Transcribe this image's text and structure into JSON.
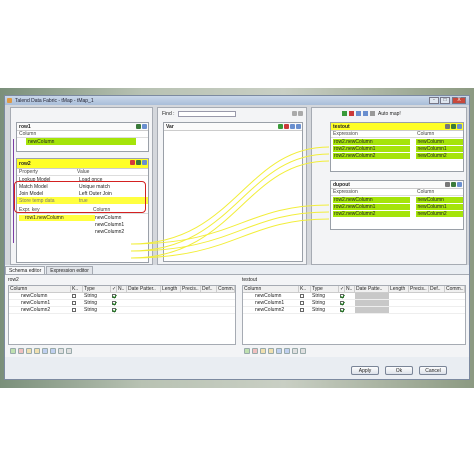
{
  "window": {
    "title": "Talend Data Fabric - tMap - tMap_1",
    "min_label": "-",
    "max_label": "□",
    "close_label": "X"
  },
  "input_row1": {
    "title": "row1",
    "col_header": "Column",
    "columns": [
      "newColumn"
    ]
  },
  "input_row2": {
    "title": "row2",
    "property_header": "Property",
    "value_header": "Value",
    "properties": [
      {
        "name": "Lookup Model",
        "value": "Load once"
      },
      {
        "name": "Match Model",
        "value": "Unique match"
      },
      {
        "name": "Join Model",
        "value": "Left Outer Join"
      },
      {
        "name": "Store temp data",
        "value": "true"
      }
    ],
    "expr_header": "Expr. key",
    "column_header": "Column",
    "rows": [
      {
        "expr": "row1.newColumn",
        "column": "newColumn"
      },
      {
        "expr": "",
        "column": "newColumn1"
      },
      {
        "expr": "",
        "column": "newColumn2"
      }
    ]
  },
  "var_panel": {
    "find_label": "Find :",
    "title": "Var"
  },
  "auto_map_label": "Auto map!",
  "output_testout": {
    "title": "testout",
    "expr_header": "Expression",
    "column_header": "Column",
    "rows": [
      {
        "expr": "row2.newColumn",
        "column": "newColumn"
      },
      {
        "expr": "row2.newColumn1",
        "column": "newColumn1"
      },
      {
        "expr": "row2.newColumn2",
        "column": "newColumn2"
      }
    ]
  },
  "output_dupout": {
    "title": "dupout",
    "expr_header": "Expression",
    "column_header": "Column",
    "rows": [
      {
        "expr": "row2.newColumn",
        "column": "newColumn"
      },
      {
        "expr": "row2.newColumn1",
        "column": "newColumn1"
      },
      {
        "expr": "row2.newColumn2",
        "column": "newColumn2"
      }
    ]
  },
  "tabs": [
    "Schema editor",
    "Expression editor"
  ],
  "schema_left": {
    "title": "row2",
    "headers": [
      "Column",
      "K..",
      "Type",
      "✓",
      "N..",
      "Date Patter..",
      "Length",
      "Precis..",
      "Def..",
      "Comm.."
    ],
    "rows": [
      {
        "column": "newColumn",
        "type": "String"
      },
      {
        "column": "newColumn1",
        "type": "String"
      },
      {
        "column": "newColumn2",
        "type": "String"
      }
    ]
  },
  "schema_right": {
    "title": "testout",
    "headers": [
      "Column",
      "K..",
      "Type",
      "✓",
      "N..",
      "Date Patte..",
      "Length",
      "Precis..",
      "Def..",
      "Comm.."
    ],
    "rows": [
      {
        "column": "newColumn",
        "type": "String"
      },
      {
        "column": "newColumn1",
        "type": "String"
      },
      {
        "column": "newColumn2",
        "type": "String"
      }
    ]
  },
  "buttons": {
    "apply": "Apply",
    "ok": "Ok",
    "cancel": "Cancel"
  },
  "colors": {
    "accent_yellow": "#ffff26",
    "accent_green": "#a5e40a",
    "highlight_red": "#d42121"
  }
}
